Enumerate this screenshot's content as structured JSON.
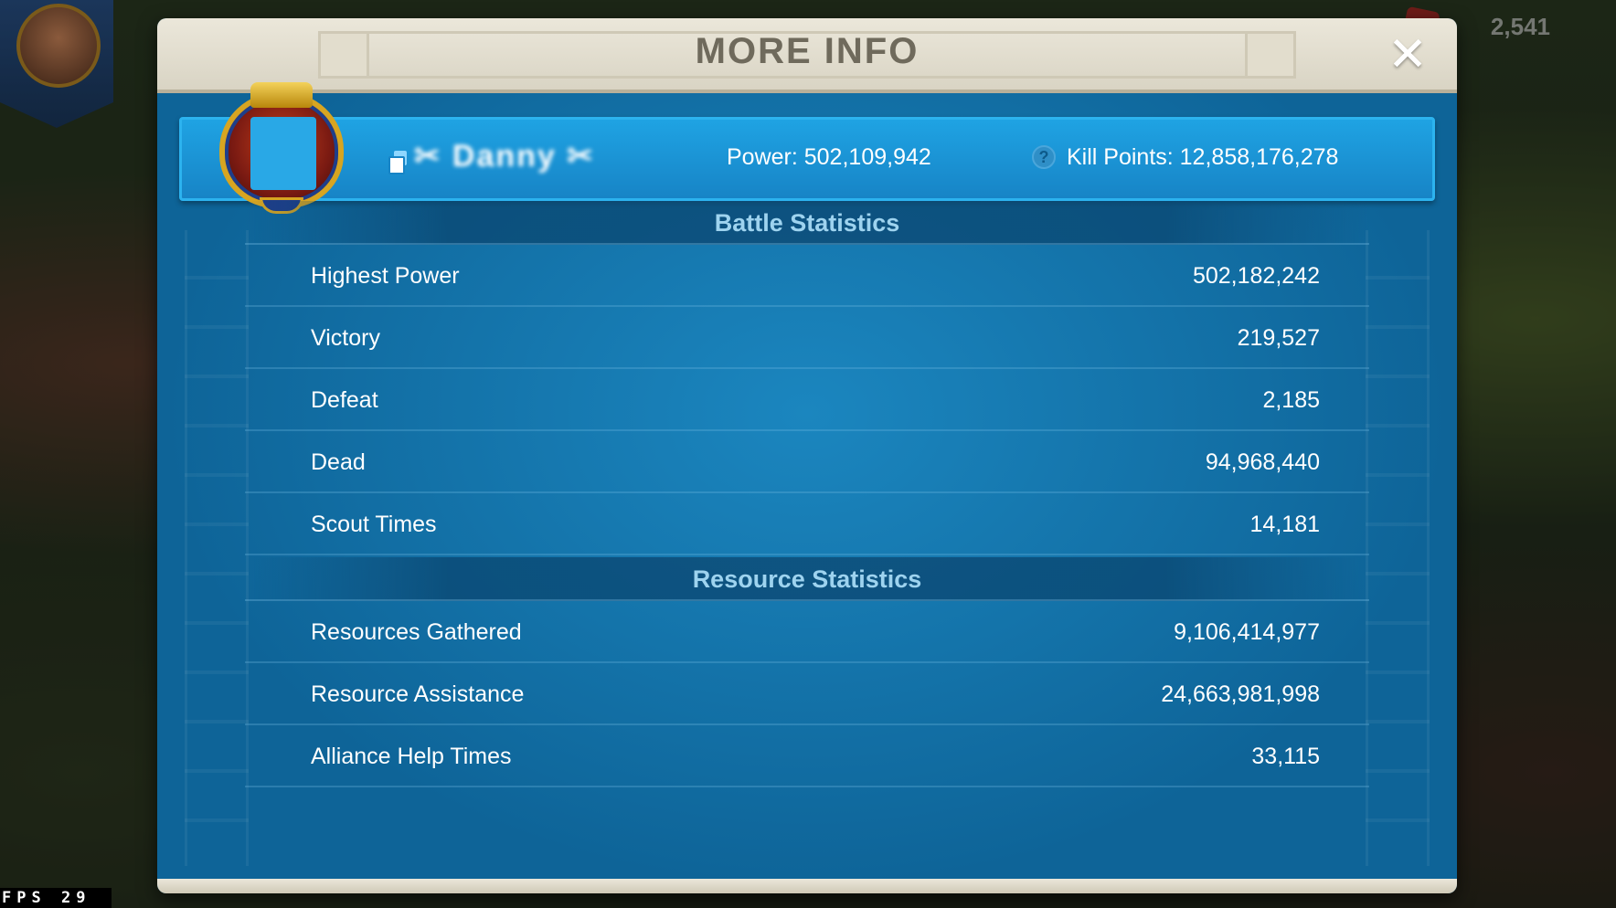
{
  "hud": {
    "gems": "2,541",
    "fps_label": "FPS",
    "fps_value": "29"
  },
  "modal": {
    "title": "MORE INFO",
    "close_icon": "close-icon"
  },
  "player": {
    "name": "✂ Danny ✂",
    "power": "Power: 502,109,942",
    "kill_points": "Kill Points: 12,858,176,278",
    "help_glyph": "?"
  },
  "battle_statistics": {
    "title": "Battle Statistics",
    "rows": [
      {
        "label": "Highest Power",
        "value": "502,182,242"
      },
      {
        "label": "Victory",
        "value": "219,527"
      },
      {
        "label": "Defeat",
        "value": "2,185"
      },
      {
        "label": "Dead",
        "value": "94,968,440"
      },
      {
        "label": "Scout Times",
        "value": "14,181"
      }
    ]
  },
  "resource_statistics": {
    "title": "Resource Statistics",
    "rows": [
      {
        "label": "Resources Gathered",
        "value": "9,106,414,977"
      },
      {
        "label": "Resource Assistance",
        "value": "24,663,981,998"
      },
      {
        "label": "Alliance Help Times",
        "value": "33,115"
      }
    ]
  },
  "colors": {
    "panel_blue": "#0f6aa0",
    "banner_blue": "#1fa3e3",
    "header_beige": "#ebe7da",
    "section_title": "#9ed3ef"
  }
}
